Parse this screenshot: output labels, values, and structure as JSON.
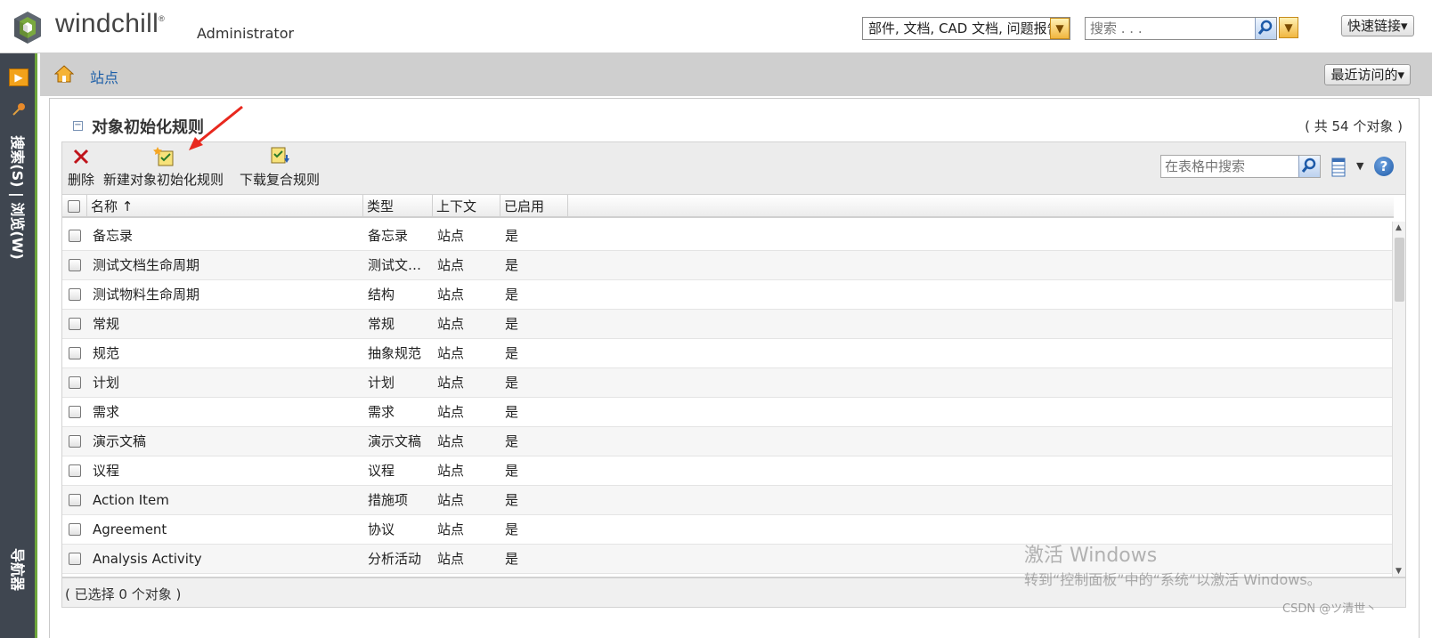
{
  "header": {
    "brand": "windchill",
    "brand_mark": "®",
    "user": "Administrator",
    "type_filter": "部件, 文档, CAD 文档, 问题报告",
    "search_placeholder": "搜索 . . .",
    "quick_links": "快速链接▾"
  },
  "leftbar": {
    "toggle_glyph": "▶",
    "search_browse": "搜索(S) | 浏览(W)",
    "navigator": "导航器"
  },
  "breadcrumb": {
    "item": "站点",
    "recent": "最近访问的▾"
  },
  "panel": {
    "title": "对象初始化规则",
    "count": "( 共 54 个对象 )",
    "collapse_glyph": "−"
  },
  "toolbar": {
    "delete": "删除",
    "new_rule": "新建对象初始化规则",
    "download_rule": "下载复合规则",
    "table_search_placeholder": "在表格中搜索",
    "help": "?"
  },
  "table": {
    "columns": [
      "名称 ↑",
      "类型",
      "上下文",
      "已启用"
    ],
    "rows": [
      {
        "name": "备忘录",
        "type": "备忘录",
        "context": "站点",
        "enabled": "是"
      },
      {
        "name": "测试文档生命周期",
        "type": "测试文…",
        "context": "站点",
        "enabled": "是"
      },
      {
        "name": "测试物料生命周期",
        "type": "结构",
        "context": "站点",
        "enabled": "是"
      },
      {
        "name": "常规",
        "type": "常规",
        "context": "站点",
        "enabled": "是"
      },
      {
        "name": "规范",
        "type": "抽象规范",
        "context": "站点",
        "enabled": "是"
      },
      {
        "name": "计划",
        "type": "计划",
        "context": "站点",
        "enabled": "是"
      },
      {
        "name": "需求",
        "type": "需求",
        "context": "站点",
        "enabled": "是"
      },
      {
        "name": "演示文稿",
        "type": "演示文稿",
        "context": "站点",
        "enabled": "是"
      },
      {
        "name": "议程",
        "type": "议程",
        "context": "站点",
        "enabled": "是"
      },
      {
        "name": "Action Item",
        "type": "措施项",
        "context": "站点",
        "enabled": "是"
      },
      {
        "name": "Agreement",
        "type": "协议",
        "context": "站点",
        "enabled": "是"
      },
      {
        "name": "Analysis Activity",
        "type": "分析活动",
        "context": "站点",
        "enabled": "是"
      }
    ],
    "selected": "( 已选择 0 个对象 )"
  },
  "overlay": {
    "activate_title": "激活 Windows",
    "activate_sub": "转到“控制面板”中的“系统”以激活 Windows。",
    "credit": "CSDN @ツ清世丶"
  },
  "colors": {
    "accent_orange": "#f1b640",
    "sidebar": "#3f4650",
    "sidebar_border": "#6ea53b",
    "link": "#1d5fa8",
    "annotation_arrow": "#e8281e"
  }
}
